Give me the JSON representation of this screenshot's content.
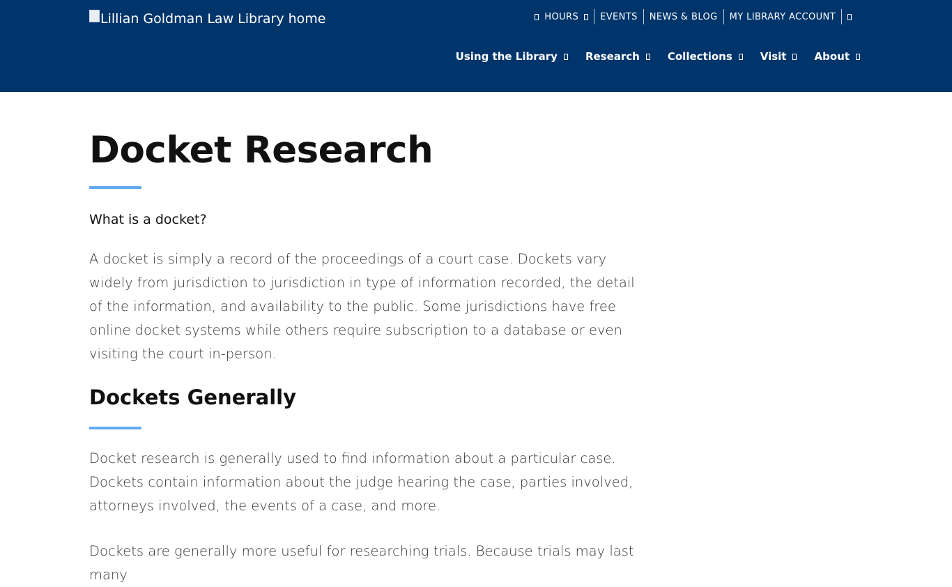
{
  "header": {
    "logo_alt": "Lillian Goldman Law Library home",
    "bg_color": "#00356b",
    "utility": [
      {
        "label": "HOURS",
        "lead_icon": "clock-icon",
        "trail_icon": "chevron-down-icon"
      },
      {
        "label": "EVENTS"
      },
      {
        "label": "NEWS & BLOG"
      },
      {
        "label": "MY LIBRARY ACCOUNT"
      },
      {
        "label": "",
        "lead_icon": "search-icon"
      }
    ],
    "nav": [
      {
        "label": "Using the Library"
      },
      {
        "label": "Research"
      },
      {
        "label": "Collections"
      },
      {
        "label": "Visit"
      },
      {
        "label": "About"
      }
    ]
  },
  "main": {
    "title": "Docket Research",
    "accent_color": "#63aaf1",
    "question": "What is a docket?",
    "intro": "A docket is simply a record of the proceedings of a court case. Dockets vary widely from jurisdiction to jurisdiction in type of information recorded, the detail of the information, and availability to the public. Some jurisdictions have free online docket systems while others require subscription to a database or even visiting the court in-person.",
    "section_heading": "Dockets Generally",
    "para1": "Docket research is generally used to find information about a particular case. Dockets contain information about the judge hearing the case, parties involved, attorneys involved, the events of a case, and more.",
    "para2": "Dockets are generally more useful for researching trials. Because trials may last many"
  }
}
